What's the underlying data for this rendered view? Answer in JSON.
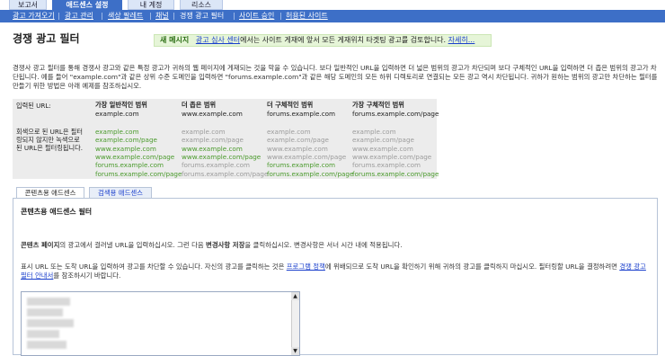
{
  "tabs": [
    "보고서",
    "애드센스 설정",
    "내 계정",
    "리소스"
  ],
  "subnav": [
    "광고 가져오기",
    "광고 관리",
    "색상 팔레트",
    "채널",
    "경쟁 광고 필터",
    "사이트 승인",
    "허용된 사이트"
  ],
  "page_title": "경쟁 광고 필터",
  "notice": {
    "label": "새 메시지",
    "link": "광고 심사 센터",
    "text": "에서는 사이트 게재에 앞서 모든 게재위치 타겟팅 광고를 검토합니다.",
    "more": "자세히..."
  },
  "intro": "경쟁사 광고 필터를 통해 경쟁사 광고와 같은 특정 광고가 귀하의 웹 페이지에 게재되는 것을 막을 수 있습니다. 보다 일반적인 URL을 입력하면 더 넓은 범위의 광고가 차단되며 보다 구체적인 URL을 입력하면 더 좁은 범위의 광고가 차단됩니다. 예를 들어 \"example.com\"과 같은 상위 수준 도메인을 입력하면 \"forums.example.com\"과 같은 해당 도메인의 모든 하위 디렉토리로 연결되는 모든 광고 역시 차단됩니다. 귀하가 원하는 범위의 광고만 차단하는 필터를 만들기 위한 방법은 아래 예제를 참조하십시오.",
  "examples": {
    "input_label": "입력된 URL:",
    "blocked_label": [
      "회색으로 된 URL은 필터",
      "링되지 않지만 녹색으로",
      "된 URL은 필터링됩니다."
    ],
    "columns": [
      {
        "header": "가장 일반적인 범위",
        "url": "example.com",
        "list": [
          "example.com",
          "example.com/page",
          "www.example.com",
          "www.example.com/page",
          "forums.example.com",
          "forums.example.com/page"
        ],
        "green": [
          true,
          true,
          true,
          true,
          true,
          true
        ]
      },
      {
        "header": "더 좁은 범위",
        "url": "www.example.com",
        "list": [
          "example.com",
          "example.com/page",
          "www.example.com",
          "www.example.com/page",
          "forums.example.com",
          "forums.example.com/page"
        ],
        "green": [
          false,
          false,
          true,
          true,
          false,
          false
        ]
      },
      {
        "header": "더 구체적인 범위",
        "url": "forums.example.com",
        "list": [
          "example.com",
          "example.com/page",
          "www.example.com",
          "www.example.com/page",
          "forums.example.com",
          "forums.example.com/page"
        ],
        "green": [
          false,
          false,
          false,
          false,
          true,
          true
        ]
      },
      {
        "header": "가장 구체적인 범위",
        "url": "forums.example.com/page",
        "list": [
          "example.com",
          "example.com/page",
          "www.example.com",
          "www.example.com/page",
          "forums.example.com",
          "forums.example.com/page"
        ],
        "green": [
          false,
          false,
          false,
          false,
          false,
          true
        ]
      }
    ]
  },
  "product_tabs": [
    "콘텐츠용 애드센스",
    "검색용 애드센스"
  ],
  "panel": {
    "title": "콘텐츠용 애드센스 필터",
    "line1_a": "콘텐츠 페이지",
    "line1_b": "의 광고에서 걸러낼 URL을 입력하십시오. 그런 다음 ",
    "line1_c": "변경사항 저장",
    "line1_d": "을 클릭하십시오. 변경사항은 서너 시간 내에 적용됩니다.",
    "line2_a": "표시 URL 또는 도착 URL을 입력하여 광고를 차단할 수 있습니다. 자신의 광고를 클릭하는 것은 ",
    "line2_link": "프로그램 정책",
    "line2_b": "에 위배되므로 도착 URL을 확인하기 위해 귀하의 광고를 클릭하지 마십시오. 필터링할 URL을 결정하려면 ",
    "line2_link2": "경쟁 광고 필터 안내서",
    "line2_c": "를 참조하시기 바랍니다."
  }
}
